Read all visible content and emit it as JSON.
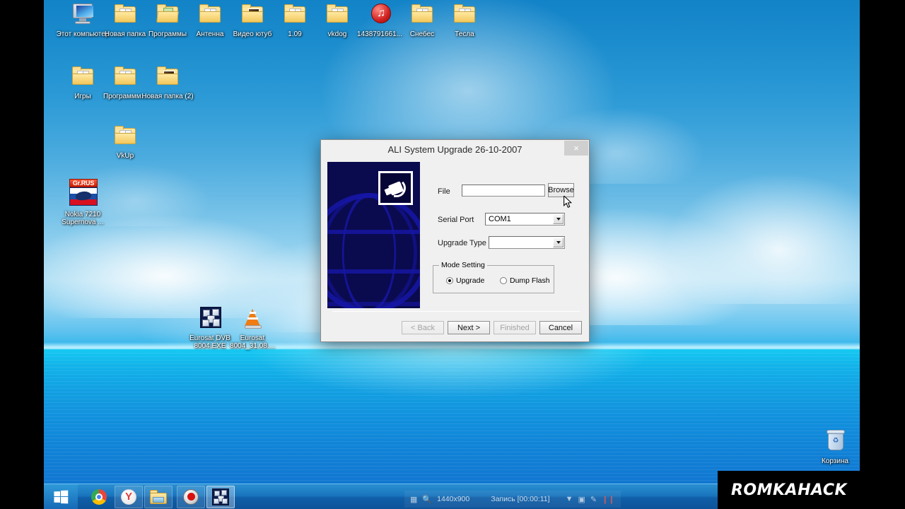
{
  "desktop": {
    "icons_row1": [
      {
        "name": "Этот компьютер",
        "type": "computer"
      },
      {
        "name": "Новая папка",
        "type": "folder"
      },
      {
        "name": "Программы",
        "type": "folder-green"
      },
      {
        "name": "Антенна",
        "type": "folder"
      },
      {
        "name": "Видео ютуб",
        "type": "folder-thumb"
      },
      {
        "name": "1.09",
        "type": "folder"
      },
      {
        "name": "vkdog",
        "type": "folder"
      },
      {
        "name": "1438791661...",
        "type": "app-red"
      },
      {
        "name": "Снебес",
        "type": "folder"
      },
      {
        "name": "Тесла",
        "type": "folder"
      }
    ],
    "icons_row2": [
      {
        "name": "Игры",
        "type": "folder"
      },
      {
        "name": "Программм...",
        "type": "folder"
      },
      {
        "name": "Новая папка (2)",
        "type": "folder-thumb"
      }
    ],
    "icons_row3": [
      {
        "name": "VkUp",
        "type": "folder"
      }
    ],
    "icon_nokia": {
      "name": "Nokia 7210 Supernova ...",
      "badge": "Gr.RUS"
    },
    "icons_bottom": [
      {
        "name": "Eurosat DVB 8004.EXE",
        "type": "blocks"
      },
      {
        "name": "Eurosat 8004_31.08....",
        "type": "vlc-cone"
      }
    ],
    "recycle_bin": "Корзина"
  },
  "taskbar": {
    "start": "start-button",
    "items": [
      {
        "name": "Google Chrome",
        "icon": "chrome-icon"
      },
      {
        "name": "Yandex Browser",
        "icon": "yandex-icon"
      },
      {
        "name": "File Explorer",
        "icon": "explorer-icon"
      },
      {
        "name": "Screen Recorder",
        "icon": "record-icon"
      },
      {
        "name": "Eurosat DVB",
        "icon": "blocks-icon"
      }
    ]
  },
  "recorder": {
    "resolution": "1440x900",
    "status": "Запись [00:00:11]",
    "icons": [
      "window-icon",
      "search-icon",
      "chevron-down-icon",
      "camera-icon",
      "pencil-icon",
      "stop-icon"
    ]
  },
  "watermark": "ROMKAHACK",
  "dialog": {
    "title": "ALI System Upgrade 26-10-2007",
    "close": "×",
    "fields": {
      "file_label": "File",
      "file_value": "",
      "browse_label": "Browse",
      "serial_port_label": "Serial Port",
      "serial_port_value": "COM1",
      "upgrade_type_label": "Upgrade Type",
      "upgrade_type_value": ""
    },
    "mode_setting": {
      "legend": "Mode Setting",
      "options": [
        {
          "label": "Upgrade",
          "selected": true
        },
        {
          "label": "Dump Flash",
          "selected": false
        }
      ]
    },
    "buttons": [
      {
        "label": "< Back",
        "disabled": true
      },
      {
        "label": "Next >",
        "disabled": false
      },
      {
        "label": "Finished",
        "disabled": true
      },
      {
        "label": "Cancel",
        "disabled": false
      }
    ]
  },
  "colors": {
    "dialog_bg": "#f0f0f0",
    "banner_bg": "#0a0a4e",
    "banner_globe": "#1616a8",
    "taskbar": "#1a76bf",
    "desktop_sky": "#2c9ad6",
    "desktop_sea": "#129fe2"
  }
}
